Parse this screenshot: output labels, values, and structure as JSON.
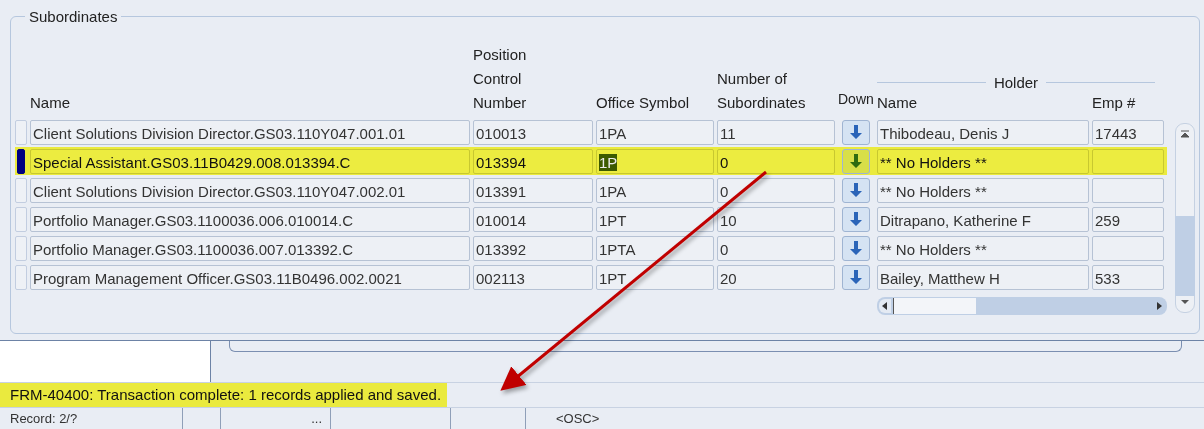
{
  "panel": {
    "title": "Subordinates"
  },
  "columns": {
    "name": "Name",
    "position_control_number": "Position Control Number",
    "office_symbol": "Office Symbol",
    "number_of_subordinates": "Number of Subordinates",
    "down": "Down",
    "holder_group": "Holder",
    "holder_name": "Name",
    "emp_no": "Emp #"
  },
  "rows": [
    {
      "name": "Client Solutions Division Director.GS03.110Y047.001.01",
      "pcn": "010013",
      "office": "1PA",
      "count": "11",
      "holder": "Thibodeau, Denis J",
      "emp": "17443",
      "selected": false
    },
    {
      "name": "Special Assistant.GS03.11B0429.008.013394.C",
      "pcn": "013394",
      "office": "1P",
      "count": "0",
      "holder": "** No Holders **",
      "emp": "",
      "selected": true
    },
    {
      "name": "Client Solutions Division Director.GS03.110Y047.002.01",
      "pcn": "013391",
      "office": "1PA",
      "count": "0",
      "holder": "** No Holders **",
      "emp": "",
      "selected": false
    },
    {
      "name": "Portfolio Manager.GS03.1100036.006.010014.C",
      "pcn": "010014",
      "office": "1PT",
      "count": "10",
      "holder": "Ditrapano, Katherine F",
      "emp": "259",
      "selected": false
    },
    {
      "name": "Portfolio Manager.GS03.1100036.007.013392.C",
      "pcn": "013392",
      "office": "1PTA",
      "count": "0",
      "holder": "** No Holders **",
      "emp": "",
      "selected": false
    },
    {
      "name": "Program Management Officer.GS03.11B0496.002.0021",
      "pcn": "002113",
      "office": "1PT",
      "count": "20",
      "holder": "Bailey, Matthew H",
      "emp": "533",
      "selected": false
    }
  ],
  "message": "FRM-40400: Transaction complete: 1 records applied and saved.",
  "status_bar": {
    "record": "Record: 2/?",
    "field_3": "...",
    "field_6": "<OSC>"
  }
}
